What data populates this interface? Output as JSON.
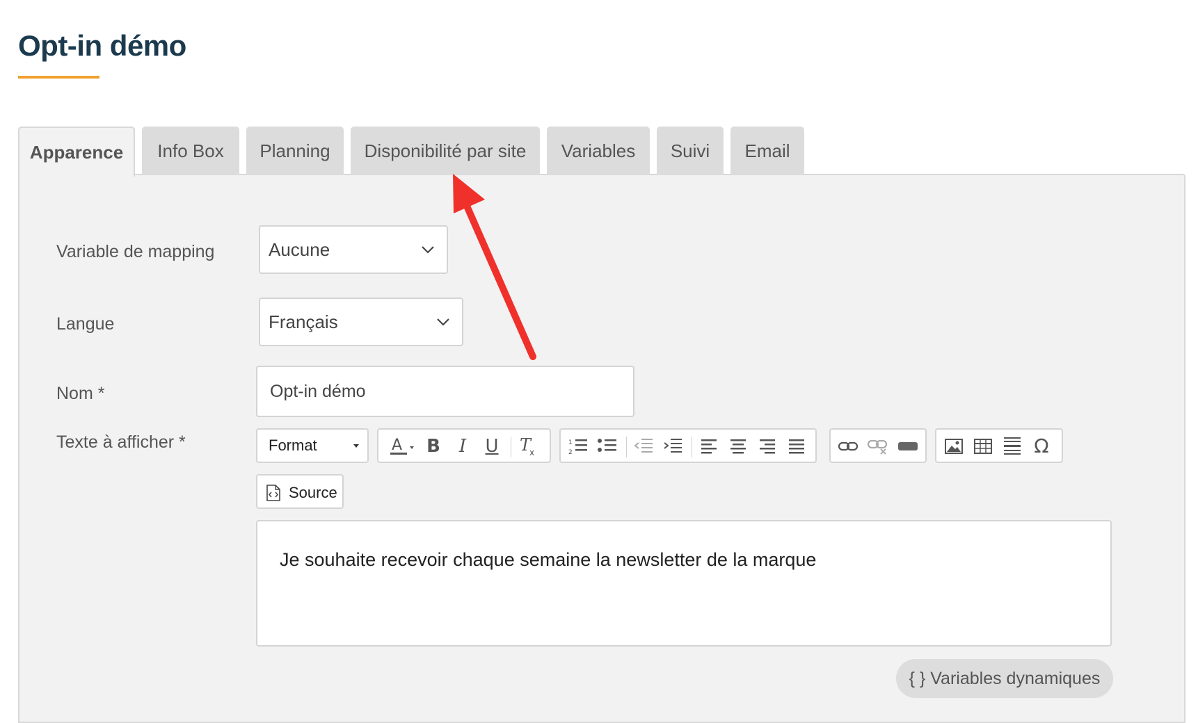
{
  "page": {
    "title": "Opt-in démo",
    "accent_color": "#f0a030",
    "title_color": "#1c3a4e"
  },
  "tabs": [
    {
      "label": "Apparence",
      "active": true
    },
    {
      "label": "Info Box",
      "active": false
    },
    {
      "label": "Planning",
      "active": false
    },
    {
      "label": "Disponibilité par site",
      "active": false
    },
    {
      "label": "Variables",
      "active": false
    },
    {
      "label": "Suivi",
      "active": false
    },
    {
      "label": "Email",
      "active": false
    }
  ],
  "form": {
    "mapping": {
      "label": "Variable de mapping",
      "value": "Aucune"
    },
    "langue": {
      "label": "Langue",
      "value": "Français"
    },
    "nom": {
      "label": "Nom *",
      "value": "Opt-in démo"
    },
    "texte": {
      "label": "Texte à afficher *",
      "content": "Je souhaite recevoir chaque semaine la newsletter de la marque"
    }
  },
  "toolbar": {
    "format_label": "Format",
    "source_label": "Source",
    "icons": [
      "text-color-icon",
      "bold-icon",
      "italic-icon",
      "underline-icon",
      "remove-format-icon",
      "numbered-list-icon",
      "bulleted-list-icon",
      "outdent-icon",
      "indent-icon",
      "align-left-icon",
      "align-center-icon",
      "align-right-icon",
      "justify-icon",
      "link-icon",
      "unlink-icon",
      "anchor-icon",
      "image-icon",
      "table-icon",
      "horizontal-rule-icon",
      "special-char-icon"
    ]
  },
  "dynamic_vars_button": {
    "label": "{ } Variables dynamiques"
  },
  "annotation": {
    "arrow_color": "#f0302a"
  }
}
